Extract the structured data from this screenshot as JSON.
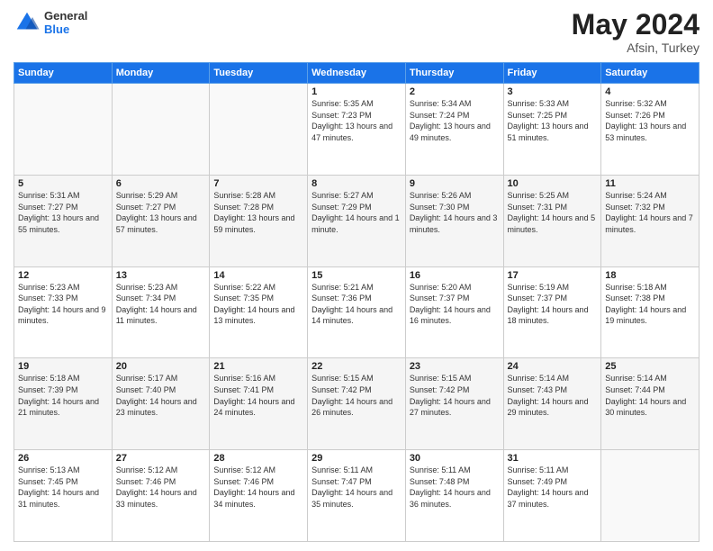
{
  "header": {
    "logo": {
      "general": "General",
      "blue": "Blue"
    },
    "title": "May 2024",
    "location": "Afsin, Turkey"
  },
  "days_of_week": [
    "Sunday",
    "Monday",
    "Tuesday",
    "Wednesday",
    "Thursday",
    "Friday",
    "Saturday"
  ],
  "weeks": [
    [
      {
        "day": "",
        "empty": true
      },
      {
        "day": "",
        "empty": true
      },
      {
        "day": "",
        "empty": true
      },
      {
        "day": "1",
        "sunrise": "5:35 AM",
        "sunset": "7:23 PM",
        "daylight": "13 hours and 47 minutes."
      },
      {
        "day": "2",
        "sunrise": "5:34 AM",
        "sunset": "7:24 PM",
        "daylight": "13 hours and 49 minutes."
      },
      {
        "day": "3",
        "sunrise": "5:33 AM",
        "sunset": "7:25 PM",
        "daylight": "13 hours and 51 minutes."
      },
      {
        "day": "4",
        "sunrise": "5:32 AM",
        "sunset": "7:26 PM",
        "daylight": "13 hours and 53 minutes."
      }
    ],
    [
      {
        "day": "5",
        "sunrise": "5:31 AM",
        "sunset": "7:27 PM",
        "daylight": "13 hours and 55 minutes."
      },
      {
        "day": "6",
        "sunrise": "5:29 AM",
        "sunset": "7:27 PM",
        "daylight": "13 hours and 57 minutes."
      },
      {
        "day": "7",
        "sunrise": "5:28 AM",
        "sunset": "7:28 PM",
        "daylight": "13 hours and 59 minutes."
      },
      {
        "day": "8",
        "sunrise": "5:27 AM",
        "sunset": "7:29 PM",
        "daylight": "14 hours and 1 minute."
      },
      {
        "day": "9",
        "sunrise": "5:26 AM",
        "sunset": "7:30 PM",
        "daylight": "14 hours and 3 minutes."
      },
      {
        "day": "10",
        "sunrise": "5:25 AM",
        "sunset": "7:31 PM",
        "daylight": "14 hours and 5 minutes."
      },
      {
        "day": "11",
        "sunrise": "5:24 AM",
        "sunset": "7:32 PM",
        "daylight": "14 hours and 7 minutes."
      }
    ],
    [
      {
        "day": "12",
        "sunrise": "5:23 AM",
        "sunset": "7:33 PM",
        "daylight": "14 hours and 9 minutes."
      },
      {
        "day": "13",
        "sunrise": "5:23 AM",
        "sunset": "7:34 PM",
        "daylight": "14 hours and 11 minutes."
      },
      {
        "day": "14",
        "sunrise": "5:22 AM",
        "sunset": "7:35 PM",
        "daylight": "14 hours and 13 minutes."
      },
      {
        "day": "15",
        "sunrise": "5:21 AM",
        "sunset": "7:36 PM",
        "daylight": "14 hours and 14 minutes."
      },
      {
        "day": "16",
        "sunrise": "5:20 AM",
        "sunset": "7:37 PM",
        "daylight": "14 hours and 16 minutes."
      },
      {
        "day": "17",
        "sunrise": "5:19 AM",
        "sunset": "7:37 PM",
        "daylight": "14 hours and 18 minutes."
      },
      {
        "day": "18",
        "sunrise": "5:18 AM",
        "sunset": "7:38 PM",
        "daylight": "14 hours and 19 minutes."
      }
    ],
    [
      {
        "day": "19",
        "sunrise": "5:18 AM",
        "sunset": "7:39 PM",
        "daylight": "14 hours and 21 minutes."
      },
      {
        "day": "20",
        "sunrise": "5:17 AM",
        "sunset": "7:40 PM",
        "daylight": "14 hours and 23 minutes."
      },
      {
        "day": "21",
        "sunrise": "5:16 AM",
        "sunset": "7:41 PM",
        "daylight": "14 hours and 24 minutes."
      },
      {
        "day": "22",
        "sunrise": "5:15 AM",
        "sunset": "7:42 PM",
        "daylight": "14 hours and 26 minutes."
      },
      {
        "day": "23",
        "sunrise": "5:15 AM",
        "sunset": "7:42 PM",
        "daylight": "14 hours and 27 minutes."
      },
      {
        "day": "24",
        "sunrise": "5:14 AM",
        "sunset": "7:43 PM",
        "daylight": "14 hours and 29 minutes."
      },
      {
        "day": "25",
        "sunrise": "5:14 AM",
        "sunset": "7:44 PM",
        "daylight": "14 hours and 30 minutes."
      }
    ],
    [
      {
        "day": "26",
        "sunrise": "5:13 AM",
        "sunset": "7:45 PM",
        "daylight": "14 hours and 31 minutes."
      },
      {
        "day": "27",
        "sunrise": "5:12 AM",
        "sunset": "7:46 PM",
        "daylight": "14 hours and 33 minutes."
      },
      {
        "day": "28",
        "sunrise": "5:12 AM",
        "sunset": "7:46 PM",
        "daylight": "14 hours and 34 minutes."
      },
      {
        "day": "29",
        "sunrise": "5:11 AM",
        "sunset": "7:47 PM",
        "daylight": "14 hours and 35 minutes."
      },
      {
        "day": "30",
        "sunrise": "5:11 AM",
        "sunset": "7:48 PM",
        "daylight": "14 hours and 36 minutes."
      },
      {
        "day": "31",
        "sunrise": "5:11 AM",
        "sunset": "7:49 PM",
        "daylight": "14 hours and 37 minutes."
      },
      {
        "day": "",
        "empty": true
      }
    ]
  ],
  "labels": {
    "sunrise_prefix": "Sunrise: ",
    "sunset_prefix": "Sunset: ",
    "daylight_prefix": "Daylight: "
  }
}
